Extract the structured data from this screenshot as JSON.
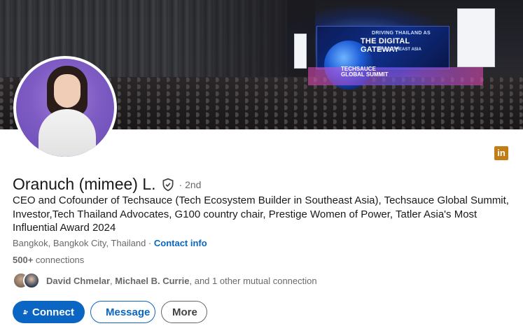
{
  "banner": {
    "screen_line1": "DRIVING THAILAND AS",
    "screen_line2": "THE DIGITAL GATEWAY",
    "screen_line3": "OF SOUTHEAST ASIA",
    "stage_line1": "TECHSAUCE",
    "stage_line2": "GLOBAL SUMMIT"
  },
  "profile": {
    "name": "Oranuch (mimee) L.",
    "degree": "· 2nd",
    "headline": "CEO and Cofounder of Techsauce (Tech Ecosystem Builder in Southeast Asia), Techsauce Global Summit, Investor,Tech Thailand Advocates, G100 country chair, Prestige Women of Power, Tatler Asia's Most Influential Award 2024",
    "location": "Bangkok, Bangkok City, Thailand",
    "location_sep": " · ",
    "contact_info": "Contact info",
    "connections_count": "500+",
    "connections_label": " connections"
  },
  "mutual": {
    "name1": "David Chmelar",
    "sep": ", ",
    "name2": "Michael B. Currie",
    "rest": ", and 1 other mutual connection"
  },
  "actions": {
    "connect": "Connect",
    "message": "Message",
    "more": "More"
  },
  "icons": {
    "linkedin": "linkedin-icon",
    "verified": "verified-shield-icon",
    "connect": "add-person-icon",
    "message": "paper-plane-icon"
  },
  "colors": {
    "brand_blue": "#0a66c2",
    "linkedin_gold": "#c37d16"
  }
}
